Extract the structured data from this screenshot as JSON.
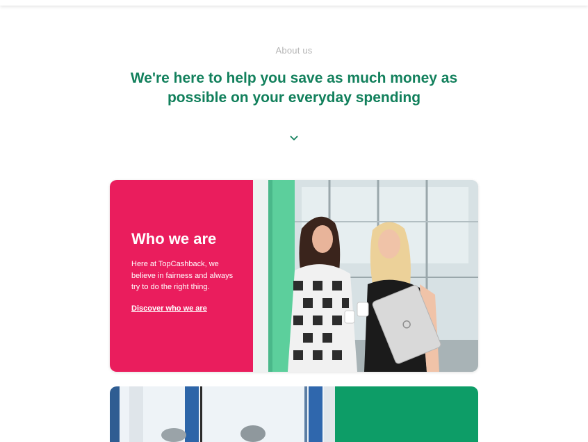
{
  "section": {
    "eyebrow": "About us",
    "headline": "We're here to help you save as much money as possible on your everyday spending"
  },
  "icons": {
    "scroll": "chevron-down-icon"
  },
  "who_we_are_card": {
    "title": "Who we are",
    "body": "Here at TopCashback, we believe in fairness and always try to do the right thing.",
    "link": "Discover who we are",
    "panel_color": "#ea1d5d",
    "photo": "two-women-talking-photo"
  },
  "next_card": {
    "panel_color": "#0d9d67",
    "photo": "office-people-photo"
  },
  "colors": {
    "headline": "#12805c",
    "eyebrow": "#b4b4b4"
  }
}
